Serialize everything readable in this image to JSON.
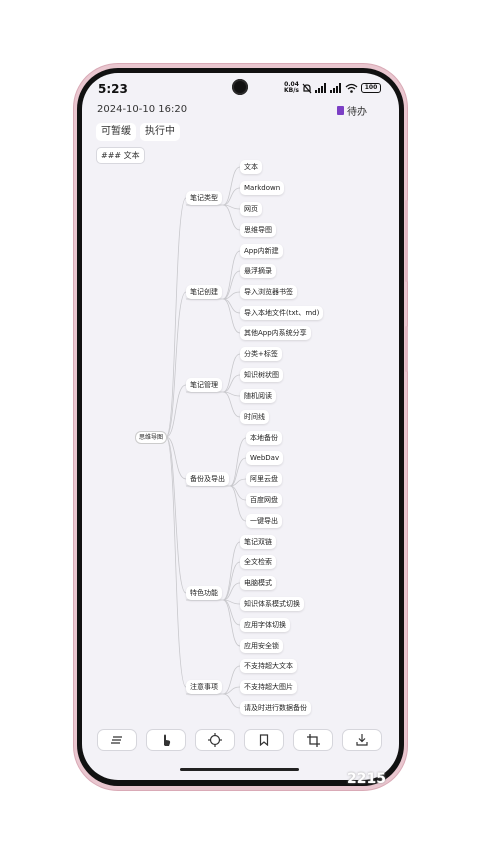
{
  "status_bar": {
    "time": "5:23",
    "net_speed_top": "0.04",
    "net_speed_bottom": "KB/s",
    "battery": "100"
  },
  "header": {
    "datetime": "2024-10-10 16:20",
    "todo_label": "待办"
  },
  "chips": [
    "可暂缓",
    "执行中"
  ],
  "tag_chip": "### 文本",
  "mindmap": {
    "root": "思维导图",
    "branches": [
      {
        "label": "笔记类型",
        "children": [
          "文本",
          "Markdown",
          "网页",
          "思维导图"
        ]
      },
      {
        "label": "笔记创建",
        "children": [
          "App内新建",
          "悬浮摘录",
          "导入浏览器书签",
          "导入本地文件(txt、md)",
          "其他App内系统分享"
        ]
      },
      {
        "label": "笔记管理",
        "children": [
          "分类+标签",
          "知识树状图",
          "随机阅读",
          "时间线"
        ]
      },
      {
        "label": "备份及导出",
        "children": [
          "本地备份",
          "WebDav",
          "阿里云盘",
          "百度网盘",
          "一键导出"
        ]
      },
      {
        "label": "特色功能",
        "children": [
          "笔记双链",
          "全文检索",
          "电脑模式",
          "知识体系模式切换",
          "应用字体切换",
          "应用安全锁"
        ]
      },
      {
        "label": "注意事项",
        "children": [
          "不支持超大文本",
          "不支持超大图片",
          "请及时进行数据备份"
        ]
      }
    ]
  },
  "toolbar": [
    "menu-lines-icon",
    "touch-hand-icon",
    "target-icon",
    "bookmark-icon",
    "crop-icon",
    "download-icon"
  ],
  "watermark": "2215",
  "colors": {
    "accent": "#7b3fc5",
    "frame": "#e9c6cf",
    "screen_bg": "#f3f2f7"
  }
}
